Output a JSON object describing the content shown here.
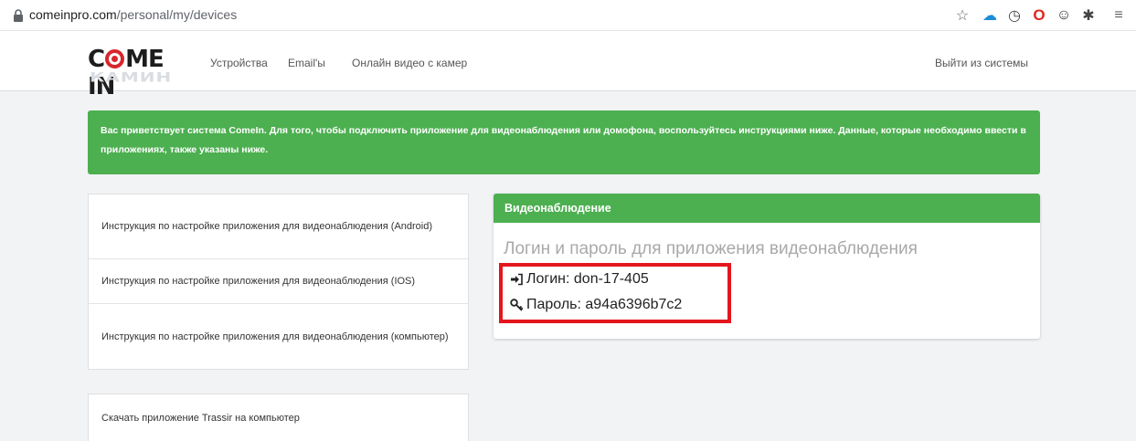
{
  "browser": {
    "url_host": "comeinpro.com",
    "url_path": "/personal/my/devices",
    "extensions": [
      {
        "icon": "star-icon",
        "symbol": "☆",
        "color": "#5f6368"
      },
      {
        "icon": "cloud-icon",
        "symbol": "☁",
        "color": "#1a8cd8"
      },
      {
        "icon": "clock-extension-icon",
        "symbol": "◷",
        "color": "#444"
      },
      {
        "icon": "opera-extension-icon",
        "symbol": "O",
        "color": "#e0261b"
      },
      {
        "icon": "ghostery-extension-icon",
        "symbol": "☺",
        "color": "#2b2b2b"
      },
      {
        "icon": "puzzle-extensions-icon",
        "symbol": "✱",
        "color": "#444"
      },
      {
        "icon": "reading-list-icon",
        "symbol": "≡",
        "color": "#5f6368"
      }
    ]
  },
  "header": {
    "logo_text_left": "C",
    "logo_text_right": "ME IN",
    "logo_shadow": "КАМИН",
    "nav": [
      "Устройства",
      "Email'ы",
      "Онлайн видео с камер"
    ],
    "logout": "Выйти из системы"
  },
  "alert": {
    "text": "Вас приветствует система ComeIn. Для того, чтобы подключить приложение для видеонаблюдения или домофона, воспользуйтесь инструкциями ниже. Данные, которые необходимо ввести в приложениях, также указаны ниже."
  },
  "instructions": [
    "Инструкция по настройке приложения для видеонаблюдения (Android)",
    "Инструкция по настройке приложения для видеонаблюдения (IOS)",
    "Инструкция по настройке приложения для видеонаблюдения (компьютер)"
  ],
  "download": "Скачать приложение Trassir на компьютер",
  "card": {
    "header": "Видеонаблюдение",
    "title": "Логин и пароль для приложения видеонаблюдения",
    "login_label": "Логин: don-17-405",
    "password_label": "Пароль: a94a6396b7c2"
  },
  "colors": {
    "accent_green": "#4caf50",
    "highlight_red": "#e4161d",
    "logo_red": "#d8262c"
  }
}
